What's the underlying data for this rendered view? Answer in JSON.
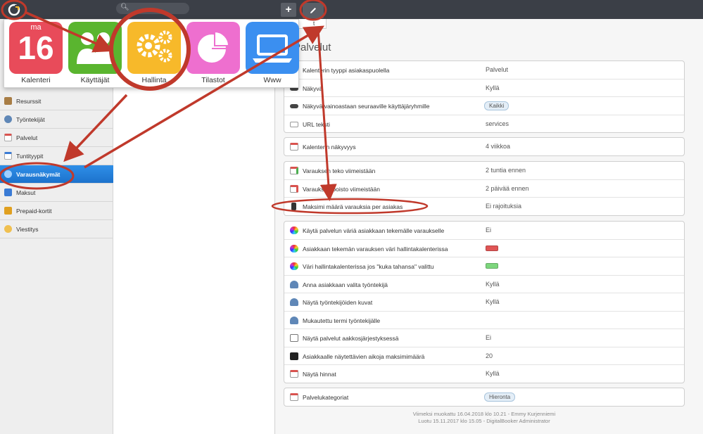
{
  "launcher": {
    "apps": [
      {
        "label": "Kalenteri",
        "icon": "calendar-icon",
        "color": "#e84b5a",
        "day": "ma",
        "date": "16"
      },
      {
        "label": "Käyttäjät",
        "icon": "users-icon",
        "color": "#5ab52f"
      },
      {
        "label": "Hallinta",
        "icon": "gears-icon",
        "color": "#f7b92a"
      },
      {
        "label": "Tilastot",
        "icon": "pie-chart-icon",
        "color": "#ee6fcf"
      },
      {
        "label": "Www",
        "icon": "laptop-icon",
        "color": "#3b8ff0"
      }
    ]
  },
  "sidebar": {
    "items": [
      {
        "label": "Resurssit",
        "icon": "resources-icon",
        "color": "#8f6a3a"
      },
      {
        "label": "Työntekijät",
        "icon": "employees-icon",
        "color": "#5f87b7"
      },
      {
        "label": "Palvelut",
        "icon": "calendar-icon",
        "color": "#d9534f"
      },
      {
        "label": "Tuntityypit",
        "icon": "calendar-icon",
        "color": "#3a7bd5"
      },
      {
        "label": "Varausnäkymät",
        "icon": "globe-icon",
        "color": "#ffffff"
      },
      {
        "label": "Maksut",
        "icon": "payment-icon",
        "color": "#3a7bd5"
      },
      {
        "label": "Prepaid-kortit",
        "icon": "card-icon",
        "color": "#e0a020"
      },
      {
        "label": "Viestitys",
        "icon": "message-icon",
        "color": "#e0b040"
      }
    ]
  },
  "main": {
    "tab_label": "t",
    "title": "Palvelut",
    "group1": [
      {
        "label": "Kalenterin tyyppi asiakaspuolella",
        "value": "Palvelut",
        "icon": "calendar-icon"
      },
      {
        "label": "Näkyvä",
        "value": "Kyllä",
        "icon": "eye-icon"
      },
      {
        "label": "Näkyvä vainoastaan seuraaville käyttäjäryhmille",
        "pill": "Kaikki",
        "icon": "eye-icon"
      },
      {
        "label": "URL teksti",
        "value": "services",
        "icon": "url-icon"
      }
    ],
    "group2": [
      {
        "label": "Kalenterin näkyvyys",
        "value": "4 viikkoa",
        "icon": "calendar-icon"
      }
    ],
    "group3": [
      {
        "label": "Varauksen teko viimeistään",
        "value": "2 tuntia ennen",
        "icon": "calendar-add-icon"
      },
      {
        "label": "Varauksen poisto viimeistään",
        "value": "2 päivää ennen",
        "icon": "calendar-remove-icon"
      },
      {
        "label": "Maksimi määrä varauksia per asiakas",
        "value": "Ei rajoituksia",
        "icon": "traffic-light-icon"
      }
    ],
    "group4": [
      {
        "label": "Käytä palvelun väriä asiakkaan tekemälle varaukselle",
        "value": "Ei",
        "icon": "color-wheel-icon"
      },
      {
        "label": "Asiakkaan tekemän varauksen väri hallintakalenterissa",
        "swatch": "#e05555",
        "icon": "color-wheel-icon"
      },
      {
        "label": "Väri hallintakalenterissa jos \"kuka tahansa\" valittu",
        "swatch": "#7dd67d",
        "icon": "color-wheel-icon"
      },
      {
        "label": "Anna asiakkaan valita työntekijä",
        "value": "Kyllä",
        "icon": "person-icon"
      },
      {
        "label": "Näytä työntekijöiden kuvat",
        "value": "Kyllä",
        "icon": "person-icon"
      },
      {
        "label": "Mukautettu termi työntekijälle",
        "value": "",
        "icon": "person-icon"
      },
      {
        "label": "Näytä palvelut aakkosjärjestyksessä",
        "value": "Ei",
        "icon": "sort-icon"
      },
      {
        "label": "Asiakkaalle näytettävien aikoja maksimimäärä",
        "value": "20",
        "icon": "counter-icon"
      },
      {
        "label": "Näytä hinnat",
        "value": "Kyllä",
        "icon": "price-icon"
      }
    ],
    "group5": [
      {
        "label": "Palvelukategoriat",
        "pill": "Hieronta",
        "icon": "calendar-icon"
      }
    ],
    "footer": {
      "modified": "Viimeksi muokattu 16.04.2018 klo 10.21 - Emmy Kurjenniemi",
      "created": "Luotu 15.11.2017 klo 15.05 - DigitalBooker Administrator"
    }
  },
  "colors": {
    "topbar": "#3b3f47",
    "active": "#1c72cc",
    "annotation": "#c0392b"
  }
}
